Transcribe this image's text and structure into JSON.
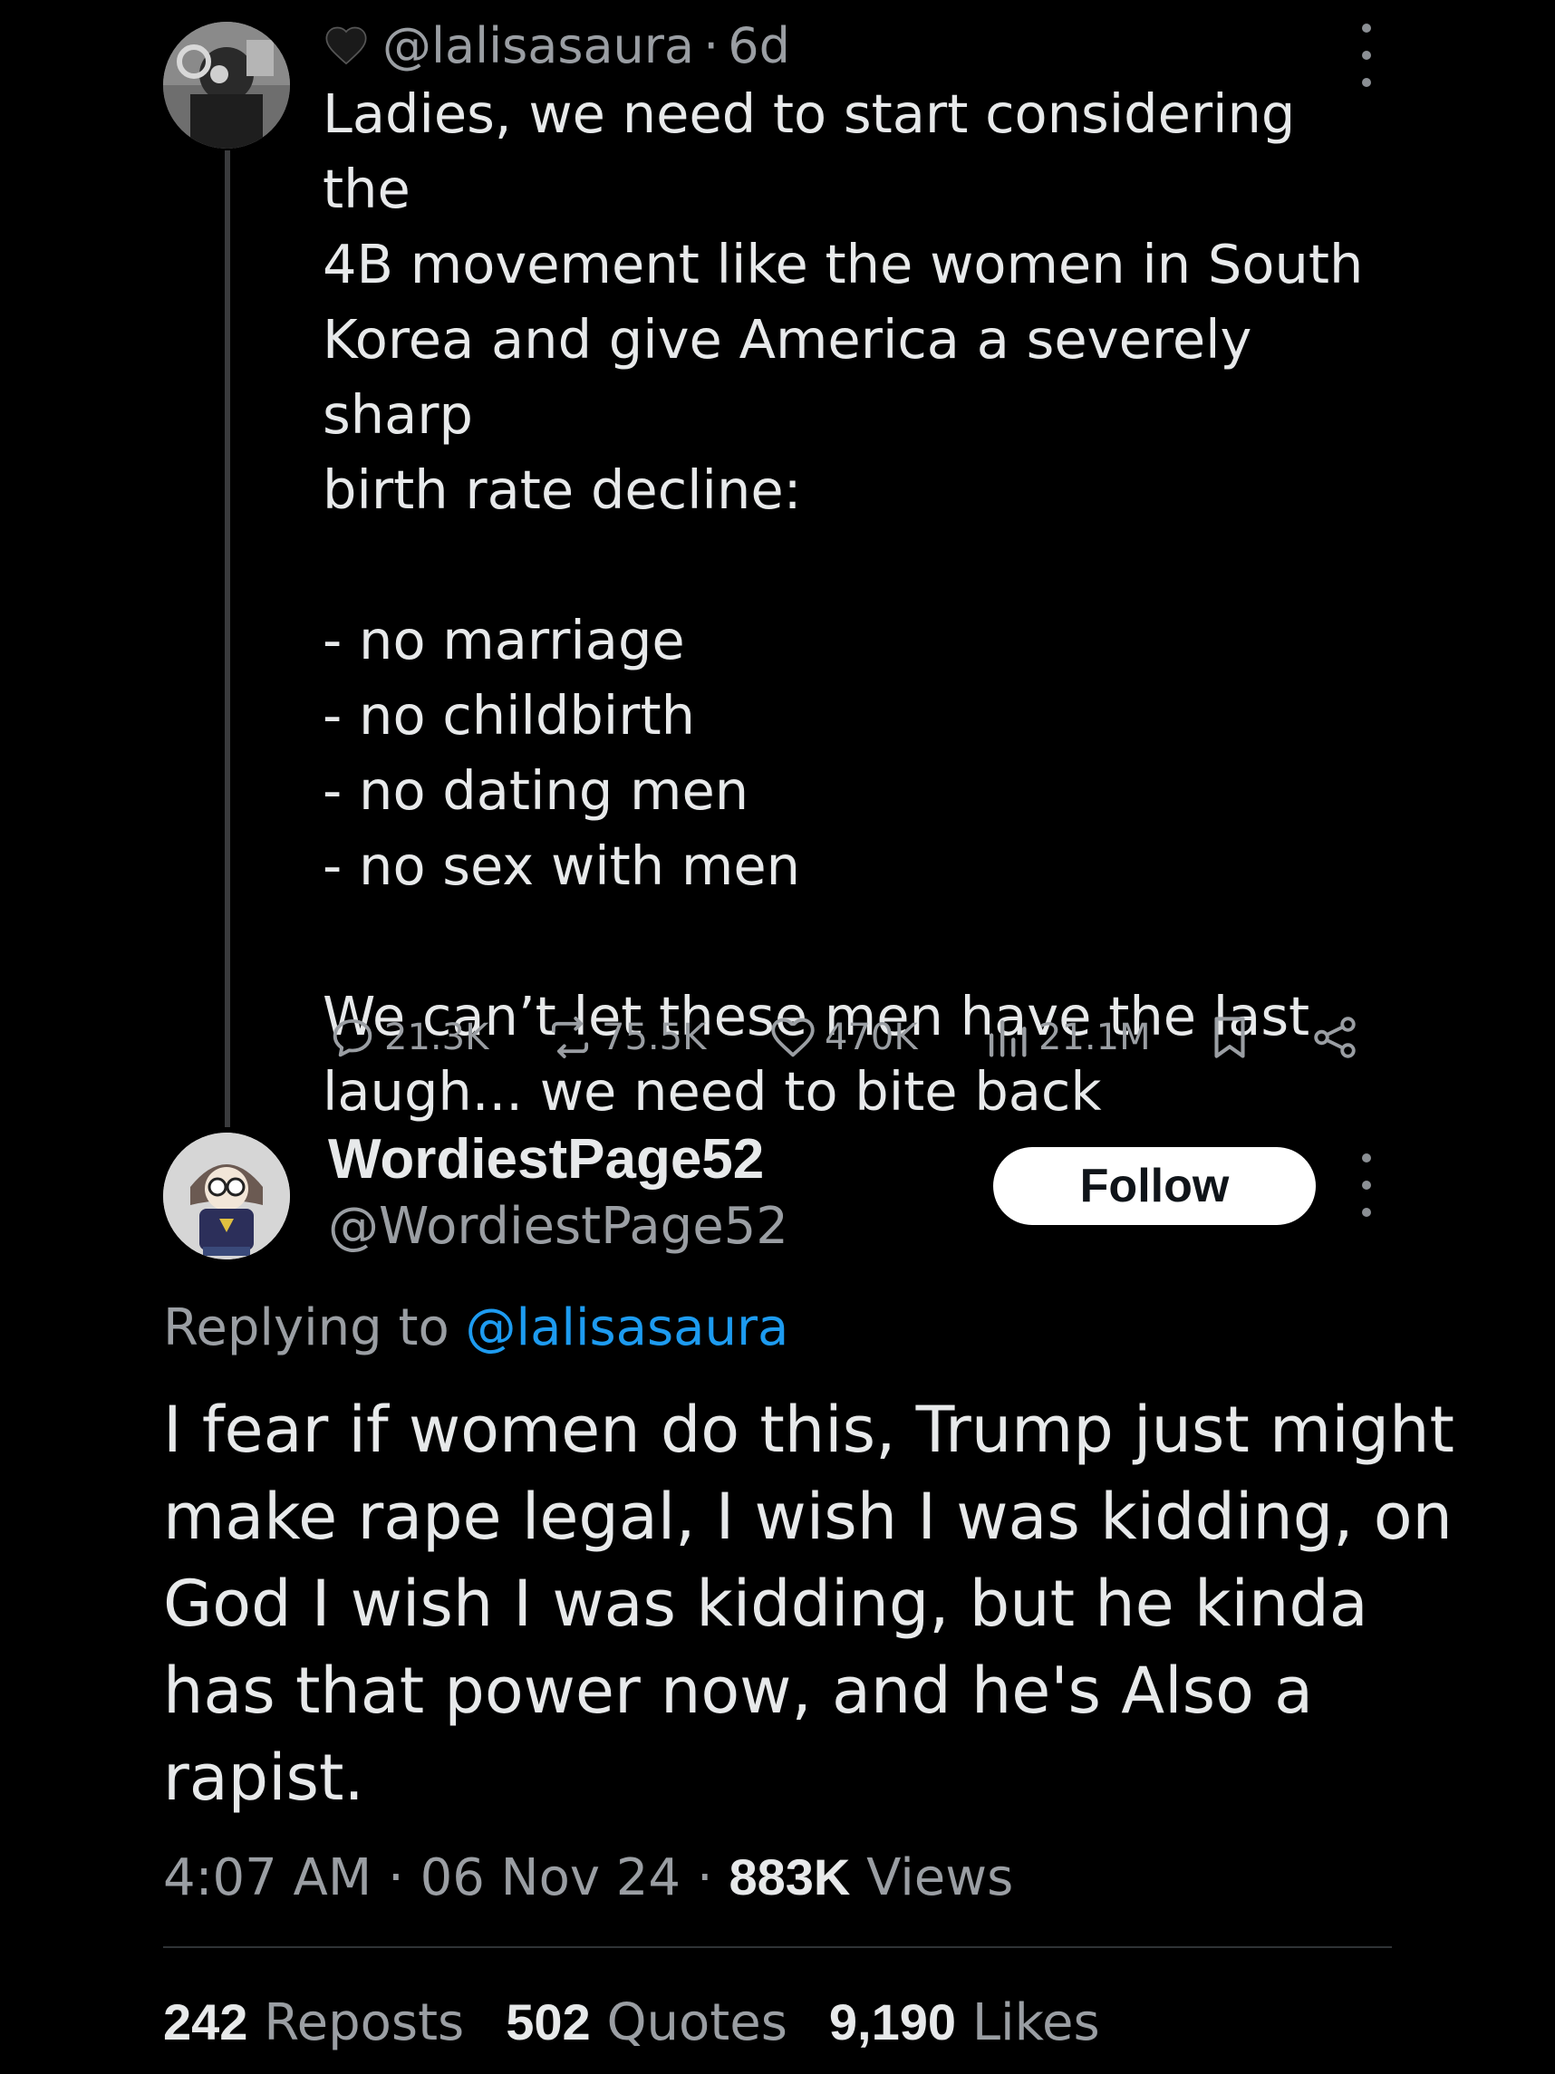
{
  "parent_tweet": {
    "handle": "@lalisasaura",
    "separator": "·",
    "age": "6d",
    "avatar_icon": "user-photo-avatar",
    "heart_icon": "black-heart-emoji",
    "body": [
      "Ladies, we need to start considering the",
      "4B movement like the women in South",
      "Korea and give America a severely sharp",
      "birth rate decline:",
      "",
      "- no marriage",
      "- no childbirth",
      "- no dating men",
      "- no sex with men",
      "",
      "We can’t let these men have the last",
      "laugh... we need to bite back"
    ],
    "actions": {
      "replies": "21.3K",
      "reposts": "75.5K",
      "likes": "470K",
      "views": "21.1M"
    }
  },
  "reply_tweet": {
    "display_name": "WordiestPage52",
    "handle": "@WordiestPage52",
    "avatar_icon": "cartoon-character-avatar",
    "follow_label": "Follow",
    "replying_to_prefix": "Replying to ",
    "replying_to_handle": "@lalisasaura",
    "body": [
      "I fear if women do this, Trump just might",
      "make rape legal, I wish I was kidding, on",
      "God I wish I was kidding, but he kinda",
      "has that power now, and he's Also a",
      "rapist."
    ],
    "time": "4:07 AM",
    "date": "06 Nov 24",
    "separator": "·",
    "views_count": "883K",
    "views_label": "Views",
    "stats": {
      "reposts_count": "242",
      "reposts_label": "Reposts",
      "quotes_count": "502",
      "quotes_label": "Quotes",
      "likes_count": "9,190",
      "likes_label": "Likes"
    }
  },
  "colors": {
    "background": "#000000",
    "primary_text": "#e7e9ea",
    "secondary_text": "#9a9ea3",
    "link": "#1d9bf0",
    "divider": "#2f3336"
  }
}
